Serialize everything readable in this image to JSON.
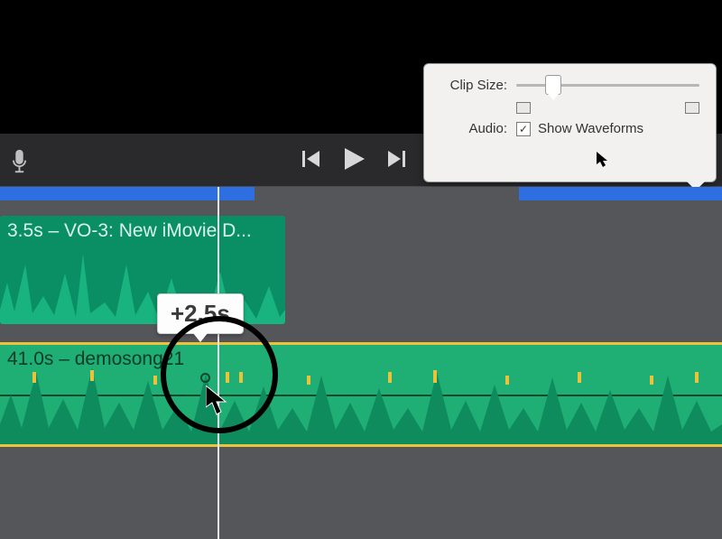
{
  "popover": {
    "clip_size_label": "Clip Size:",
    "audio_label": "Audio:",
    "show_waveforms_label": "Show Waveforms",
    "show_waveforms_checked": "✓"
  },
  "timeline": {
    "clip1_title": "3.5s – VO-3: New iMovie D...",
    "clip2_title": "41.0s – demosong21",
    "tooltip": "+2.5s"
  }
}
